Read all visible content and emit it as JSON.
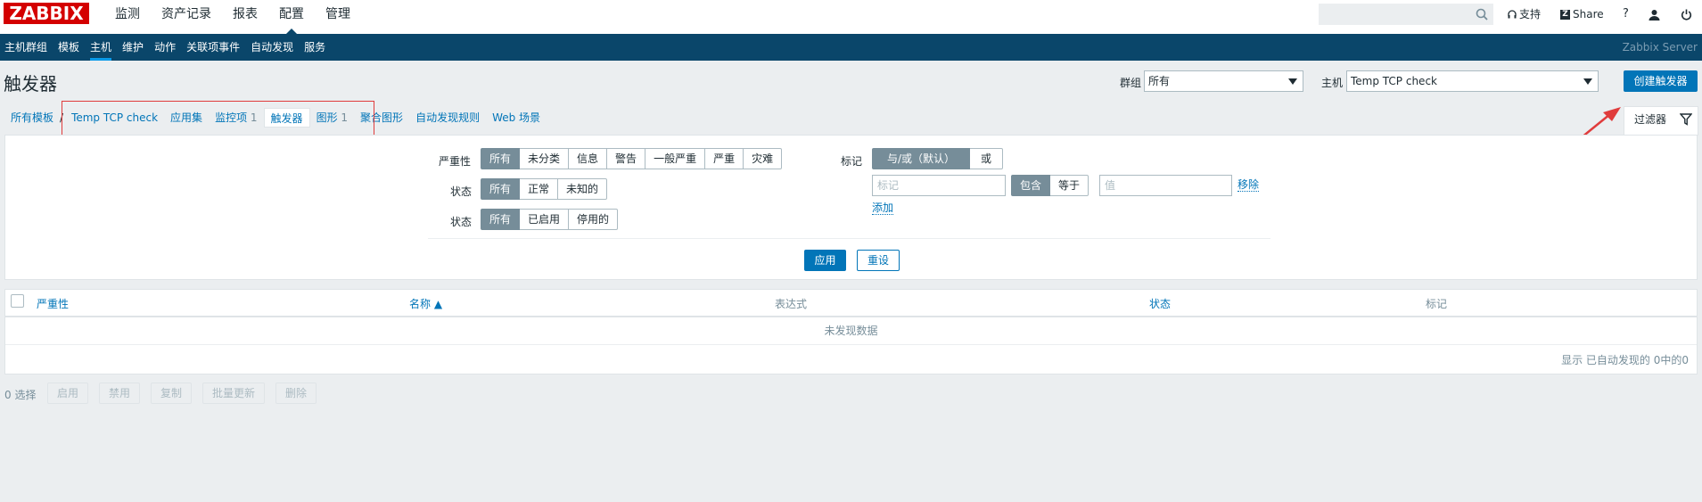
{
  "app": {
    "logo_text": "ZABBIX",
    "top_menu": [
      "监测",
      "资产记录",
      "报表",
      "配置",
      "管理"
    ],
    "active_top": "配置",
    "search_placeholder": "",
    "support_label": "支持",
    "share_label": "Share",
    "help_label": "?",
    "brand_color": "#d40000",
    "nav_color": "#0a466a",
    "accent_color": "#0275b8"
  },
  "subnav": {
    "items": [
      "主机群组",
      "模板",
      "主机",
      "维护",
      "动作",
      "关联项事件",
      "自动发现",
      "服务"
    ],
    "active": "主机",
    "server_name": "Zabbix Server"
  },
  "header": {
    "title": "触发器",
    "group_label": "群组",
    "group_value": "所有",
    "host_label": "主机",
    "host_value": "Temp TCP check",
    "create_button": "创建触发器"
  },
  "tabs": {
    "all_templates": "所有模板",
    "sep": "/",
    "host": "Temp TCP check",
    "apps": "应用集",
    "items": "监控项",
    "items_count": "1",
    "triggers": "触发器",
    "graphs": "图形",
    "graphs_count": "1",
    "screens": "聚合图形",
    "discovery": "自动发现规则",
    "web": "Web 场景",
    "filter_tab": "过滤器"
  },
  "filter": {
    "severity_label": "严重性",
    "severity_options": [
      "所有",
      "未分类",
      "信息",
      "警告",
      "一般严重",
      "严重",
      "灾难"
    ],
    "severity_selected": "所有",
    "state_label": "状态",
    "state_options": [
      "所有",
      "正常",
      "未知的"
    ],
    "status_label": "状态",
    "status_options": [
      "所有",
      "已启用",
      "停用的"
    ],
    "tags_label": "标记",
    "tags_logic_options": [
      "与/或（默认）",
      "或"
    ],
    "tag_placeholder": "标记",
    "tag_op_options": [
      "包含",
      "等于"
    ],
    "value_placeholder": "值",
    "remove_link": "移除",
    "add_link": "添加",
    "apply_button": "应用",
    "reset_button": "重设"
  },
  "table": {
    "columns": [
      "严重性",
      "名称 ▲",
      "表达式",
      "状态",
      "标记"
    ],
    "no_data": "未发现数据",
    "footer": "显示 已自动发现的 0中的0"
  },
  "actions": {
    "selected": "0 选择",
    "buttons": [
      "启用",
      "禁用",
      "复制",
      "批量更新",
      "删除"
    ]
  }
}
